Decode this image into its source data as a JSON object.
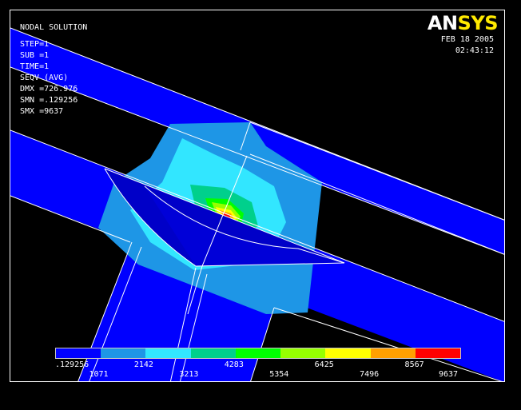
{
  "header": {
    "title": "NODAL SOLUTION",
    "lines": [
      "STEP=1",
      "SUB =1",
      "TIME=1",
      "SEQV      (AVG)",
      "DMX =726.976",
      "SMN =.129256",
      "SMX =9637"
    ]
  },
  "logo": {
    "part1": "AN",
    "part2": "SYS",
    "color1": "#ffffff",
    "color2": "#ffea00"
  },
  "stamp": {
    "date": "FEB 18 2005",
    "time": "02:43:12"
  },
  "legend": {
    "colors": [
      "#0000ff",
      "#1e96e6",
      "#32e6ff",
      "#00d08c",
      "#00ff00",
      "#96ff00",
      "#ffff00",
      "#ffa000",
      "#ff0000"
    ],
    "labels": [
      ".129256",
      "1071",
      "2142",
      "3213",
      "4283",
      "5354",
      "6425",
      "7496",
      "8567",
      "9637"
    ]
  },
  "colors": {
    "background": "#000000",
    "frame": "#ffffff",
    "mesh": "#ffffff"
  }
}
